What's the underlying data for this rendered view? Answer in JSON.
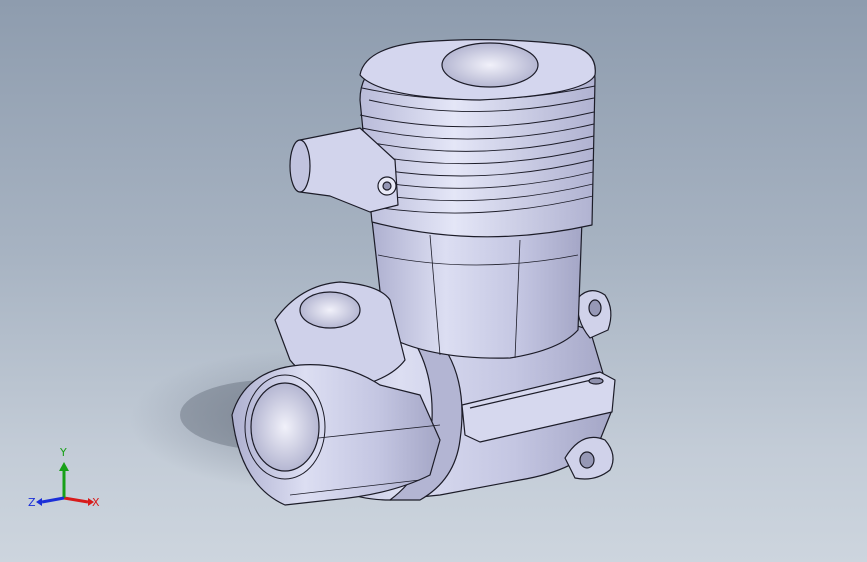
{
  "viewport": {
    "background_top": "#8e9cae",
    "background_bottom": "#cdd5de"
  },
  "model": {
    "body_color": "#c9cbe6",
    "shadow_color": "#8c96a6",
    "edge_color": "#1c1c28"
  },
  "triad": {
    "x_label": "X",
    "y_label": "Y",
    "z_label": "Z",
    "x_color": "#d81b1b",
    "y_color": "#18a018",
    "z_color": "#1b2fd8"
  }
}
